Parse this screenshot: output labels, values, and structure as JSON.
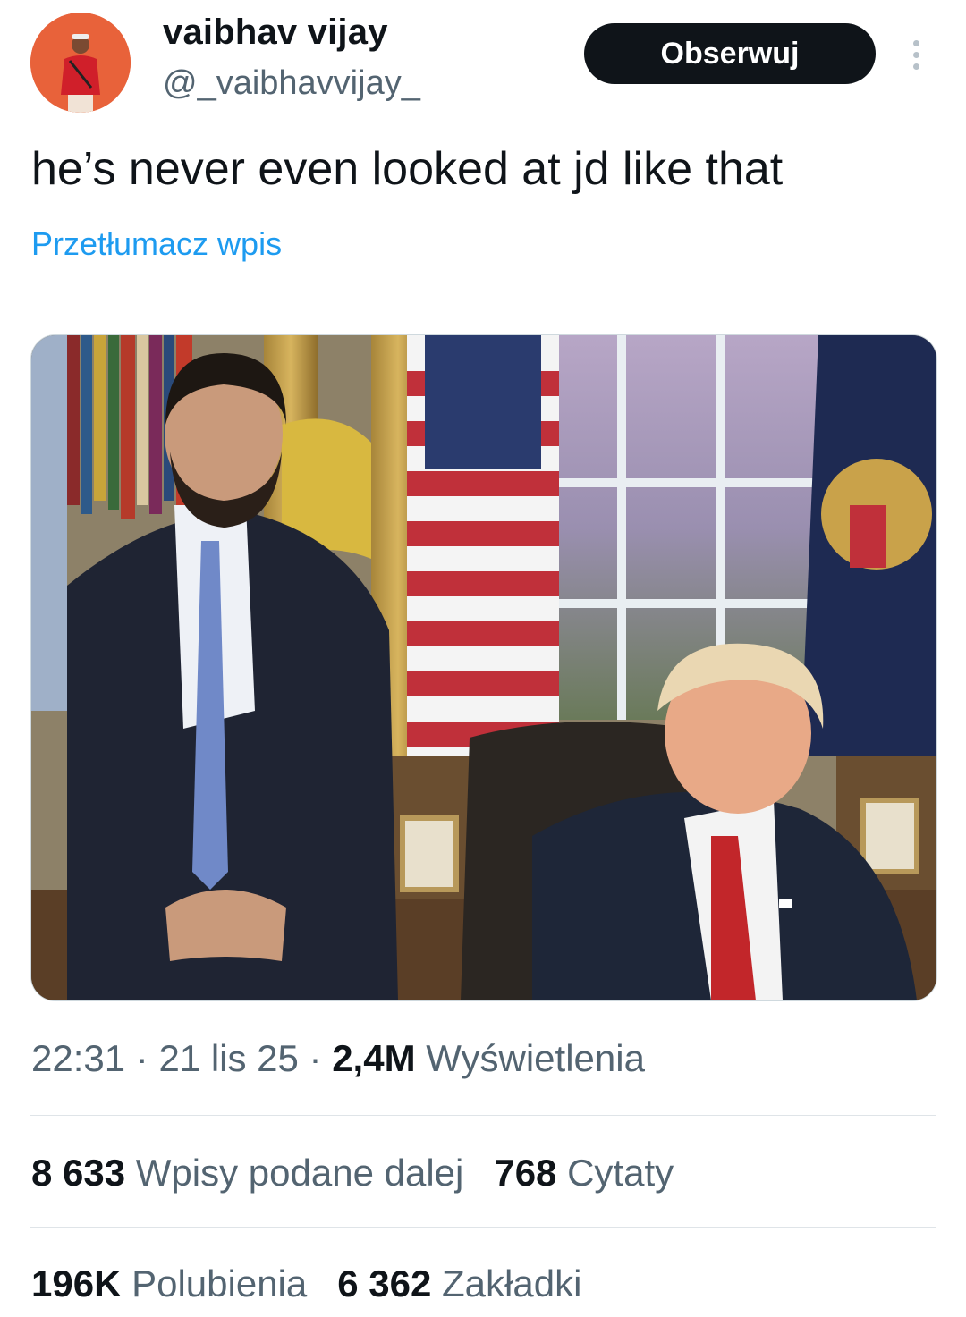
{
  "author": {
    "display_name": "vaibhav vijay",
    "handle": "@_vaibhavvijay_"
  },
  "actions": {
    "follow_label": "Obserwuj",
    "more_icon": "more-vertical-icon"
  },
  "tweet": {
    "text": "he’s never even looked at jd like that",
    "translate_label": "Przetłumacz wpis"
  },
  "meta": {
    "time": "22:31",
    "separator": " · ",
    "date": "21 lis 25",
    "views_count": "2,4M",
    "views_label": "Wyświetlenia"
  },
  "stats": {
    "reposts": {
      "count": "8 633",
      "label": "Wpisy podane dalej"
    },
    "quotes": {
      "count": "768",
      "label": "Cytaty"
    },
    "likes": {
      "count": "196K",
      "label": "Polubienia"
    },
    "bookmarks": {
      "count": "6 362",
      "label": "Zakładki"
    }
  },
  "colors": {
    "text_primary": "#0f1419",
    "text_secondary": "#536471",
    "link": "#1d9bf0",
    "avatar_bg": "#e8623a"
  }
}
